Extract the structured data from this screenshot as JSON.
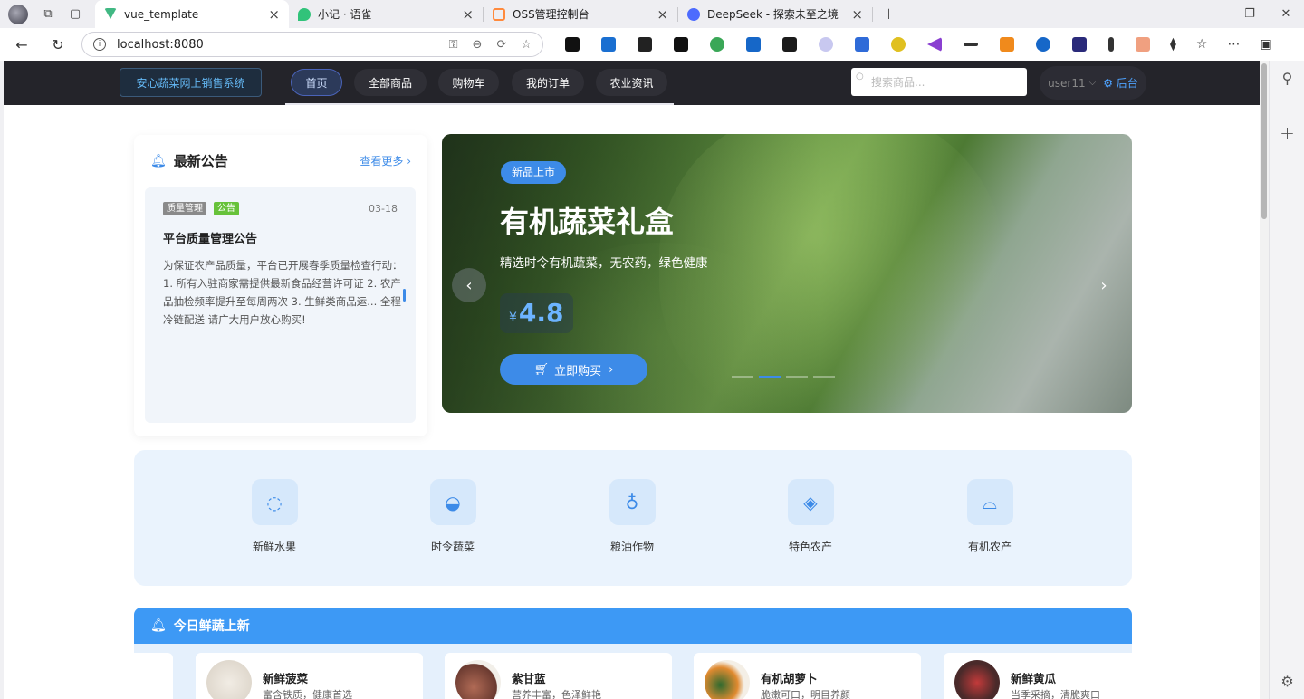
{
  "browser": {
    "tabs": [
      {
        "label": "vue_template",
        "color": "#41b883"
      },
      {
        "label": "小记 · 语雀",
        "color": "#31c37a"
      },
      {
        "label": "OSS管理控制台",
        "color": "#ff8a3d"
      },
      {
        "label": "DeepSeek - 探索未至之境",
        "color": "#4d6bfe"
      }
    ],
    "url": "localhost:8080"
  },
  "nav": {
    "brand": "安心蔬菜网上销售系统",
    "items": [
      "首页",
      "全部商品",
      "购物车",
      "我的订单",
      "农业资讯"
    ],
    "search_placeholder": "搜索商品...",
    "username": "user11",
    "admin": "后台"
  },
  "notice": {
    "title": "最新公告",
    "more": "查看更多",
    "item": {
      "tags": [
        "质量管理",
        "公告"
      ],
      "date": "03-18",
      "title": "平台质量管理公告",
      "text": "为保证农产品质量，平台已开展春季质量检查行动： 1. 所有入驻商家需提供最新食品经营许可证 2. 农产品抽检频率提升至每周两次 3. 生鲜类商品运... 全程冷链配送 请广大用户放心购买!"
    }
  },
  "banner": {
    "tag": "新品上市",
    "title": "有机蔬菜礼盒",
    "subtitle": "精选时令有机蔬菜，无农药，绿色健康",
    "currency": "¥",
    "price": "4.8",
    "buy": "立即购买",
    "slides": 4,
    "active_slide": 1
  },
  "categories": [
    {
      "label": "新鲜水果",
      "icon": "apple-icon"
    },
    {
      "label": "时令蔬菜",
      "icon": "bowl-icon"
    },
    {
      "label": "粮油作物",
      "icon": "goblet-icon"
    },
    {
      "label": "特色农产",
      "icon": "candy-icon"
    },
    {
      "label": "有机农产",
      "icon": "cloche-icon"
    }
  ],
  "new_today": {
    "title": "今日鲜蔬上新",
    "products": [
      {
        "name": "新鲜菠菜",
        "desc": "富含铁质，健康首选",
        "color": "#e9e4dc"
      },
      {
        "name": "紫甘蓝",
        "desc": "营养丰富，色泽鲜艳",
        "color": "#9c5a4a"
      },
      {
        "name": "有机胡萝卜",
        "desc": "脆嫩可口，明目养颜",
        "color": "#d9822b"
      },
      {
        "name": "新鲜黄瓜",
        "desc": "当季采摘，清脆爽口",
        "color": "#5a3a3a"
      }
    ]
  }
}
